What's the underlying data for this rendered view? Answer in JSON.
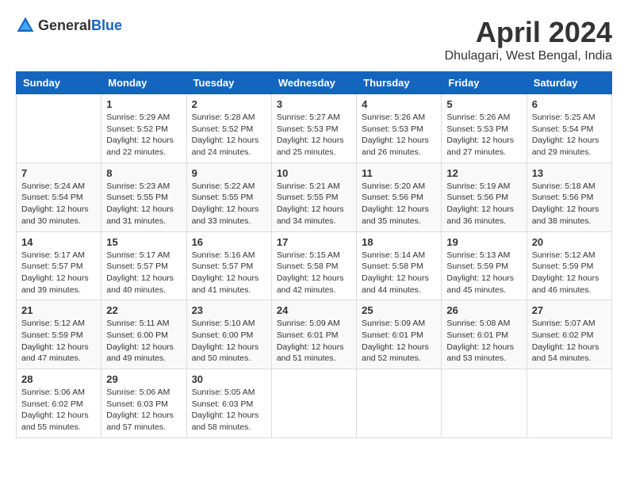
{
  "header": {
    "logo_general": "General",
    "logo_blue": "Blue",
    "month_year": "April 2024",
    "location": "Dhulagari, West Bengal, India"
  },
  "weekdays": [
    "Sunday",
    "Monday",
    "Tuesday",
    "Wednesday",
    "Thursday",
    "Friday",
    "Saturday"
  ],
  "weeks": [
    [
      {
        "day": "",
        "sunrise": "",
        "sunset": "",
        "daylight": ""
      },
      {
        "day": "1",
        "sunrise": "Sunrise: 5:29 AM",
        "sunset": "Sunset: 5:52 PM",
        "daylight": "Daylight: 12 hours and 22 minutes."
      },
      {
        "day": "2",
        "sunrise": "Sunrise: 5:28 AM",
        "sunset": "Sunset: 5:52 PM",
        "daylight": "Daylight: 12 hours and 24 minutes."
      },
      {
        "day": "3",
        "sunrise": "Sunrise: 5:27 AM",
        "sunset": "Sunset: 5:53 PM",
        "daylight": "Daylight: 12 hours and 25 minutes."
      },
      {
        "day": "4",
        "sunrise": "Sunrise: 5:26 AM",
        "sunset": "Sunset: 5:53 PM",
        "daylight": "Daylight: 12 hours and 26 minutes."
      },
      {
        "day": "5",
        "sunrise": "Sunrise: 5:26 AM",
        "sunset": "Sunset: 5:53 PM",
        "daylight": "Daylight: 12 hours and 27 minutes."
      },
      {
        "day": "6",
        "sunrise": "Sunrise: 5:25 AM",
        "sunset": "Sunset: 5:54 PM",
        "daylight": "Daylight: 12 hours and 29 minutes."
      }
    ],
    [
      {
        "day": "7",
        "sunrise": "Sunrise: 5:24 AM",
        "sunset": "Sunset: 5:54 PM",
        "daylight": "Daylight: 12 hours and 30 minutes."
      },
      {
        "day": "8",
        "sunrise": "Sunrise: 5:23 AM",
        "sunset": "Sunset: 5:55 PM",
        "daylight": "Daylight: 12 hours and 31 minutes."
      },
      {
        "day": "9",
        "sunrise": "Sunrise: 5:22 AM",
        "sunset": "Sunset: 5:55 PM",
        "daylight": "Daylight: 12 hours and 33 minutes."
      },
      {
        "day": "10",
        "sunrise": "Sunrise: 5:21 AM",
        "sunset": "Sunset: 5:55 PM",
        "daylight": "Daylight: 12 hours and 34 minutes."
      },
      {
        "day": "11",
        "sunrise": "Sunrise: 5:20 AM",
        "sunset": "Sunset: 5:56 PM",
        "daylight": "Daylight: 12 hours and 35 minutes."
      },
      {
        "day": "12",
        "sunrise": "Sunrise: 5:19 AM",
        "sunset": "Sunset: 5:56 PM",
        "daylight": "Daylight: 12 hours and 36 minutes."
      },
      {
        "day": "13",
        "sunrise": "Sunrise: 5:18 AM",
        "sunset": "Sunset: 5:56 PM",
        "daylight": "Daylight: 12 hours and 38 minutes."
      }
    ],
    [
      {
        "day": "14",
        "sunrise": "Sunrise: 5:17 AM",
        "sunset": "Sunset: 5:57 PM",
        "daylight": "Daylight: 12 hours and 39 minutes."
      },
      {
        "day": "15",
        "sunrise": "Sunrise: 5:17 AM",
        "sunset": "Sunset: 5:57 PM",
        "daylight": "Daylight: 12 hours and 40 minutes."
      },
      {
        "day": "16",
        "sunrise": "Sunrise: 5:16 AM",
        "sunset": "Sunset: 5:57 PM",
        "daylight": "Daylight: 12 hours and 41 minutes."
      },
      {
        "day": "17",
        "sunrise": "Sunrise: 5:15 AM",
        "sunset": "Sunset: 5:58 PM",
        "daylight": "Daylight: 12 hours and 42 minutes."
      },
      {
        "day": "18",
        "sunrise": "Sunrise: 5:14 AM",
        "sunset": "Sunset: 5:58 PM",
        "daylight": "Daylight: 12 hours and 44 minutes."
      },
      {
        "day": "19",
        "sunrise": "Sunrise: 5:13 AM",
        "sunset": "Sunset: 5:59 PM",
        "daylight": "Daylight: 12 hours and 45 minutes."
      },
      {
        "day": "20",
        "sunrise": "Sunrise: 5:12 AM",
        "sunset": "Sunset: 5:59 PM",
        "daylight": "Daylight: 12 hours and 46 minutes."
      }
    ],
    [
      {
        "day": "21",
        "sunrise": "Sunrise: 5:12 AM",
        "sunset": "Sunset: 5:59 PM",
        "daylight": "Daylight: 12 hours and 47 minutes."
      },
      {
        "day": "22",
        "sunrise": "Sunrise: 5:11 AM",
        "sunset": "Sunset: 6:00 PM",
        "daylight": "Daylight: 12 hours and 49 minutes."
      },
      {
        "day": "23",
        "sunrise": "Sunrise: 5:10 AM",
        "sunset": "Sunset: 6:00 PM",
        "daylight": "Daylight: 12 hours and 50 minutes."
      },
      {
        "day": "24",
        "sunrise": "Sunrise: 5:09 AM",
        "sunset": "Sunset: 6:01 PM",
        "daylight": "Daylight: 12 hours and 51 minutes."
      },
      {
        "day": "25",
        "sunrise": "Sunrise: 5:09 AM",
        "sunset": "Sunset: 6:01 PM",
        "daylight": "Daylight: 12 hours and 52 minutes."
      },
      {
        "day": "26",
        "sunrise": "Sunrise: 5:08 AM",
        "sunset": "Sunset: 6:01 PM",
        "daylight": "Daylight: 12 hours and 53 minutes."
      },
      {
        "day": "27",
        "sunrise": "Sunrise: 5:07 AM",
        "sunset": "Sunset: 6:02 PM",
        "daylight": "Daylight: 12 hours and 54 minutes."
      }
    ],
    [
      {
        "day": "28",
        "sunrise": "Sunrise: 5:06 AM",
        "sunset": "Sunset: 6:02 PM",
        "daylight": "Daylight: 12 hours and 55 minutes."
      },
      {
        "day": "29",
        "sunrise": "Sunrise: 5:06 AM",
        "sunset": "Sunset: 6:03 PM",
        "daylight": "Daylight: 12 hours and 57 minutes."
      },
      {
        "day": "30",
        "sunrise": "Sunrise: 5:05 AM",
        "sunset": "Sunset: 6:03 PM",
        "daylight": "Daylight: 12 hours and 58 minutes."
      },
      {
        "day": "",
        "sunrise": "",
        "sunset": "",
        "daylight": ""
      },
      {
        "day": "",
        "sunrise": "",
        "sunset": "",
        "daylight": ""
      },
      {
        "day": "",
        "sunrise": "",
        "sunset": "",
        "daylight": ""
      },
      {
        "day": "",
        "sunrise": "",
        "sunset": "",
        "daylight": ""
      }
    ]
  ]
}
